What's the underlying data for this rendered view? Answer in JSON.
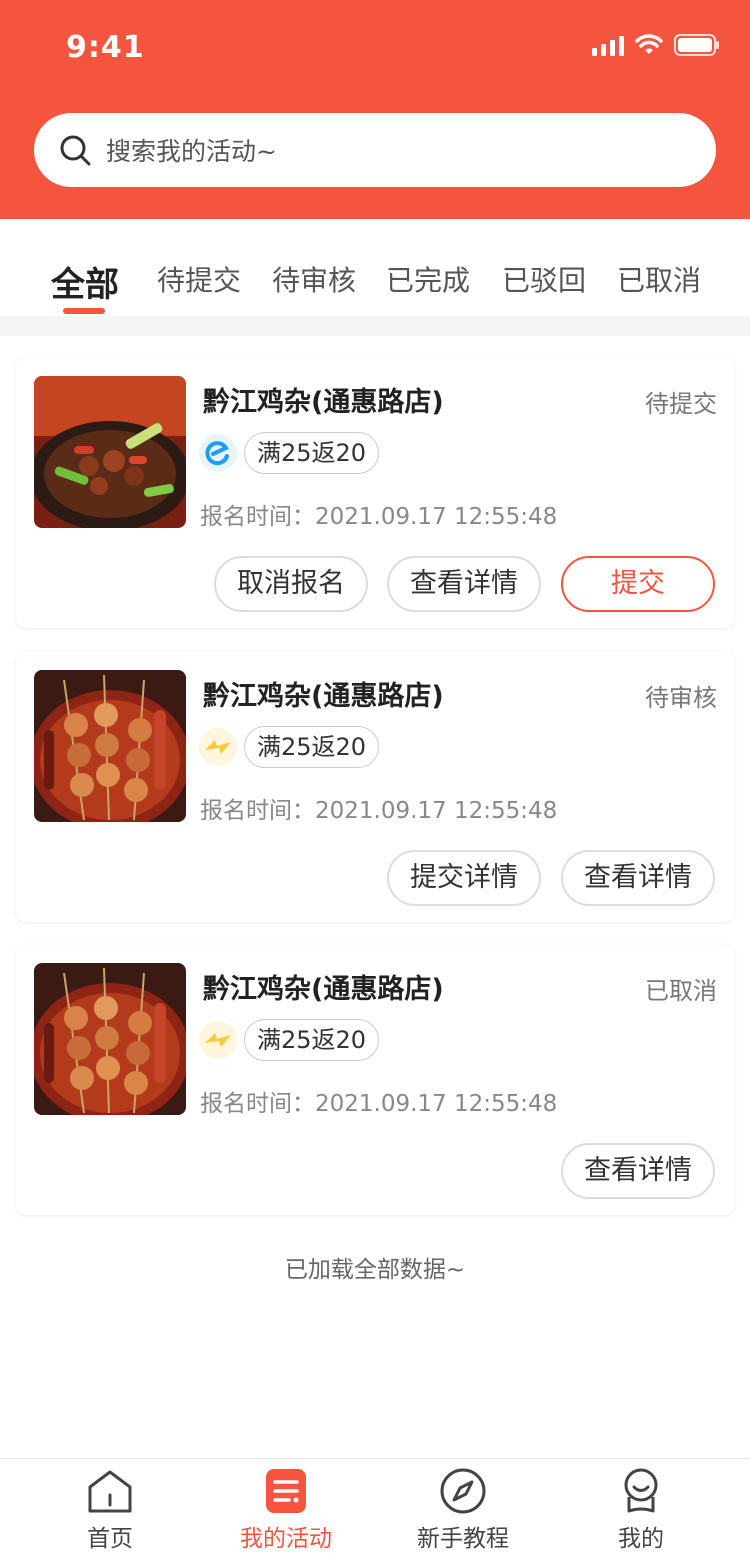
{
  "status_bar": {
    "time": "9:41"
  },
  "search": {
    "placeholder": "搜索我的活动~"
  },
  "tabs": [
    {
      "label": "全部",
      "active": true
    },
    {
      "label": "待提交"
    },
    {
      "label": "待审核"
    },
    {
      "label": "已完成"
    },
    {
      "label": "已驳回"
    },
    {
      "label": "已取消"
    }
  ],
  "cards": [
    {
      "title": "黔江鸡杂(通惠路店)",
      "status": "待提交",
      "platform_icon": "eleme-icon",
      "tag": "满25返20",
      "time": "报名时间：2021.09.17 12:55:48",
      "buttons": [
        "取消报名",
        "查看详情",
        "提交"
      ]
    },
    {
      "title": "黔江鸡杂(通惠路店)",
      "status": "待审核",
      "platform_icon": "meituan-icon",
      "tag": "满25返20",
      "time": "报名时间：2021.09.17 12:55:48",
      "buttons": [
        "提交详情",
        "查看详情"
      ]
    },
    {
      "title": "黔江鸡杂(通惠路店)",
      "status": "已取消",
      "platform_icon": "meituan-icon",
      "tag": "满25返20",
      "time": "报名时间：2021.09.17 12:55:48",
      "buttons": [
        "查看详情"
      ]
    }
  ],
  "end_text": "已加载全部数据~",
  "tabbar": [
    {
      "label": "首页",
      "icon": "home-icon"
    },
    {
      "label": "我的活动",
      "icon": "activity-list-icon",
      "active": true
    },
    {
      "label": "新手教程",
      "icon": "compass-icon"
    },
    {
      "label": "我的",
      "icon": "profile-icon"
    }
  ],
  "colors": {
    "brand": "#F5553F",
    "eleme_blue": "#1E9EF0",
    "meituan_yellow": "#FFC93B"
  }
}
